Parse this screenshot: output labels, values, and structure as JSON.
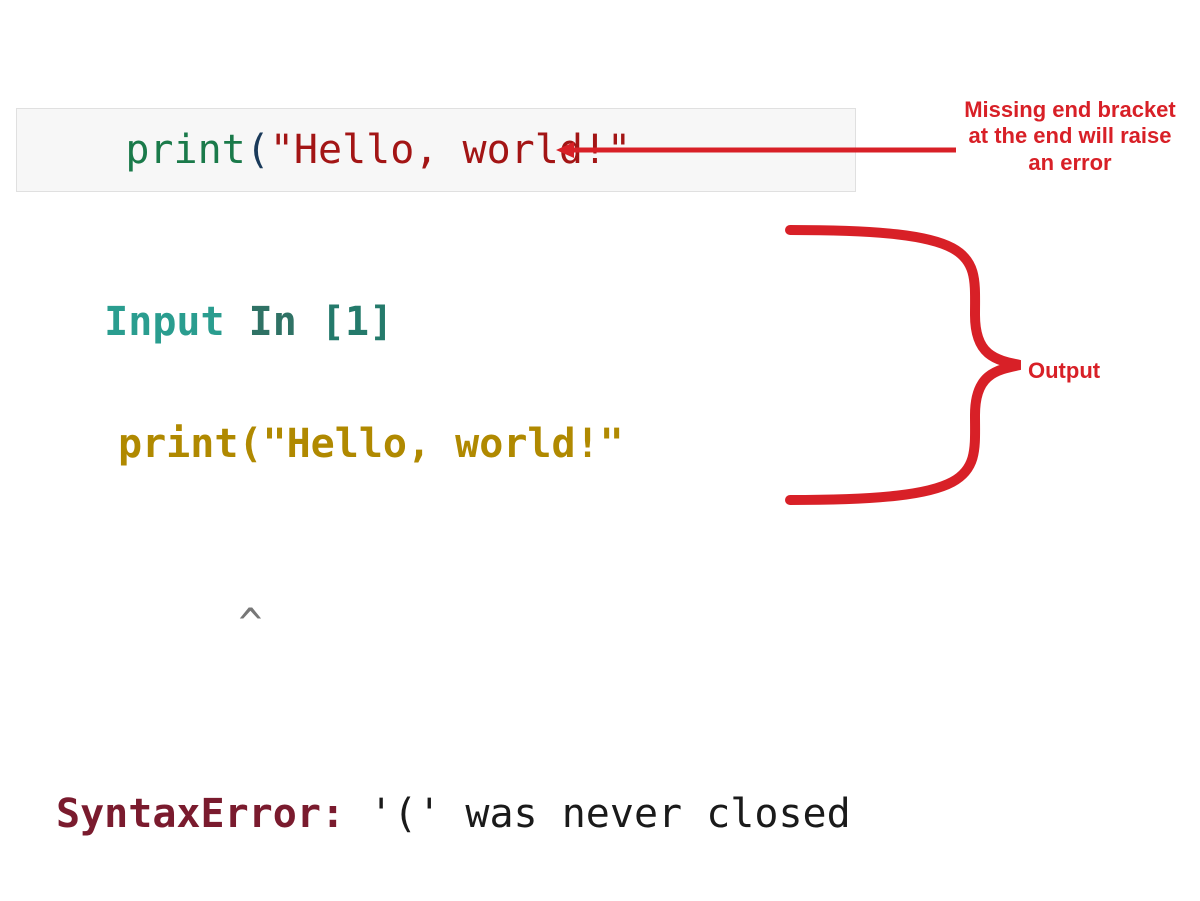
{
  "code_cell": {
    "tokens": {
      "func": "print",
      "open_paren": "(",
      "string": "\"Hello, world!\""
    }
  },
  "output": {
    "input_label": "Input ",
    "in_label": "In ",
    "bracket_open": "[",
    "index": "1",
    "bracket_close": "]",
    "echoed_code": "print(\"Hello, world!\"",
    "caret_indent": "print",
    "caret": "^",
    "error_name": "SyntaxError:",
    "error_msg": " '(' was never closed"
  },
  "annotations": {
    "missing_bracket": "Missing end bracket at the end will raise an error",
    "output_label": "Output"
  },
  "colors": {
    "annotation_red": "#d82027"
  }
}
